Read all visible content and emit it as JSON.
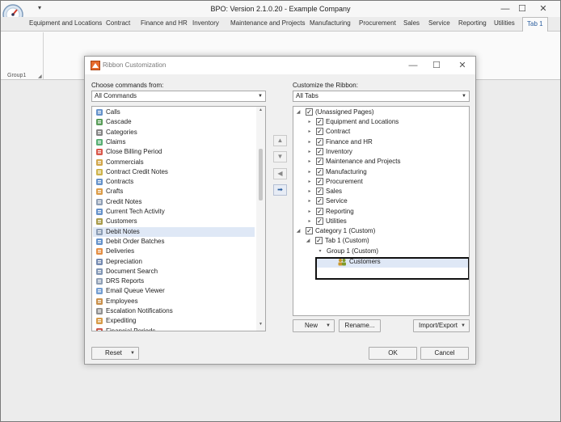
{
  "app": {
    "title": "BPO: Version 2.1.0.20 - Example Company",
    "qat_arrow": "▾",
    "minimize": "—",
    "maximize": "☐",
    "close": "✕"
  },
  "ribbon": {
    "tabs": [
      {
        "label": "Equipment and Locations"
      },
      {
        "label": "Contract"
      },
      {
        "label": "Finance and HR"
      },
      {
        "label": "Inventory"
      },
      {
        "label": "Maintenance and Projects"
      },
      {
        "label": "Manufacturing"
      },
      {
        "label": "Procurement"
      },
      {
        "label": "Sales"
      },
      {
        "label": "Service"
      },
      {
        "label": "Reporting"
      },
      {
        "label": "Utilities"
      },
      {
        "label": "Tab 1"
      }
    ],
    "active_tab": "Tab 1",
    "group_label": "Group1"
  },
  "dialog": {
    "title": "Ribbon Customization",
    "maximize": "☐",
    "close": "✕",
    "left_label": "Choose commands from:",
    "left_combo": "All Commands",
    "right_label": "Customize the Ribbon:",
    "right_combo": "All Tabs",
    "commands": [
      {
        "label": "Calls",
        "icon": "phone-icon"
      },
      {
        "label": "Cascade",
        "icon": "cascade-icon"
      },
      {
        "label": "Categories",
        "icon": "categories-icon"
      },
      {
        "label": "Claims",
        "icon": "claims-icon"
      },
      {
        "label": "Close Billing Period",
        "icon": "close-red-icon"
      },
      {
        "label": "Commercials",
        "icon": "commercials-icon"
      },
      {
        "label": "Contract Credit Notes",
        "icon": "credit-notes-icon"
      },
      {
        "label": "Contracts",
        "icon": "contracts-icon"
      },
      {
        "label": "Crafts",
        "icon": "crafts-icon"
      },
      {
        "label": "Credit Notes",
        "icon": "document-icon"
      },
      {
        "label": "Current Tech Activity",
        "icon": "tech-activity-icon"
      },
      {
        "label": "Customers",
        "icon": "customers-icon"
      },
      {
        "label": "Debit Notes",
        "icon": "document-icon"
      },
      {
        "label": "Debit Order Batches",
        "icon": "batches-icon"
      },
      {
        "label": "Deliveries",
        "icon": "deliveries-icon"
      },
      {
        "label": "Depreciation",
        "icon": "depreciation-icon"
      },
      {
        "label": "Document Search",
        "icon": "search-document-icon"
      },
      {
        "label": "DRS Reports",
        "icon": "document-icon"
      },
      {
        "label": "Email Queue Viewer",
        "icon": "email-icon"
      },
      {
        "label": "Employees",
        "icon": "employees-icon"
      },
      {
        "label": "Escalation Notifications",
        "icon": "notifications-icon"
      },
      {
        "label": "Expediting",
        "icon": "expediting-icon"
      },
      {
        "label": "Financial Periods",
        "icon": "financial-periods-icon"
      }
    ],
    "selected_command": "Debit Notes",
    "move_buttons": [
      "▲",
      "▼",
      "◀",
      "➡"
    ],
    "tree": {
      "unassigned": "(Unassigned Pages)",
      "pages": [
        "Equipment and Locations",
        "Contract",
        "Finance and HR",
        "Inventory",
        "Maintenance and Projects",
        "Manufacturing",
        "Procurement",
        "Sales",
        "Service",
        "Reporting",
        "Utilities"
      ],
      "category": "Category 1 (Custom)",
      "tab": "Tab 1 (Custom)",
      "group": "Group 1 (Custom)",
      "item": "Customers"
    },
    "buttons": {
      "new": "New",
      "rename": "Rename...",
      "import_export": "Import/Export",
      "reset": "Reset",
      "ok": "OK",
      "cancel": "Cancel"
    }
  }
}
